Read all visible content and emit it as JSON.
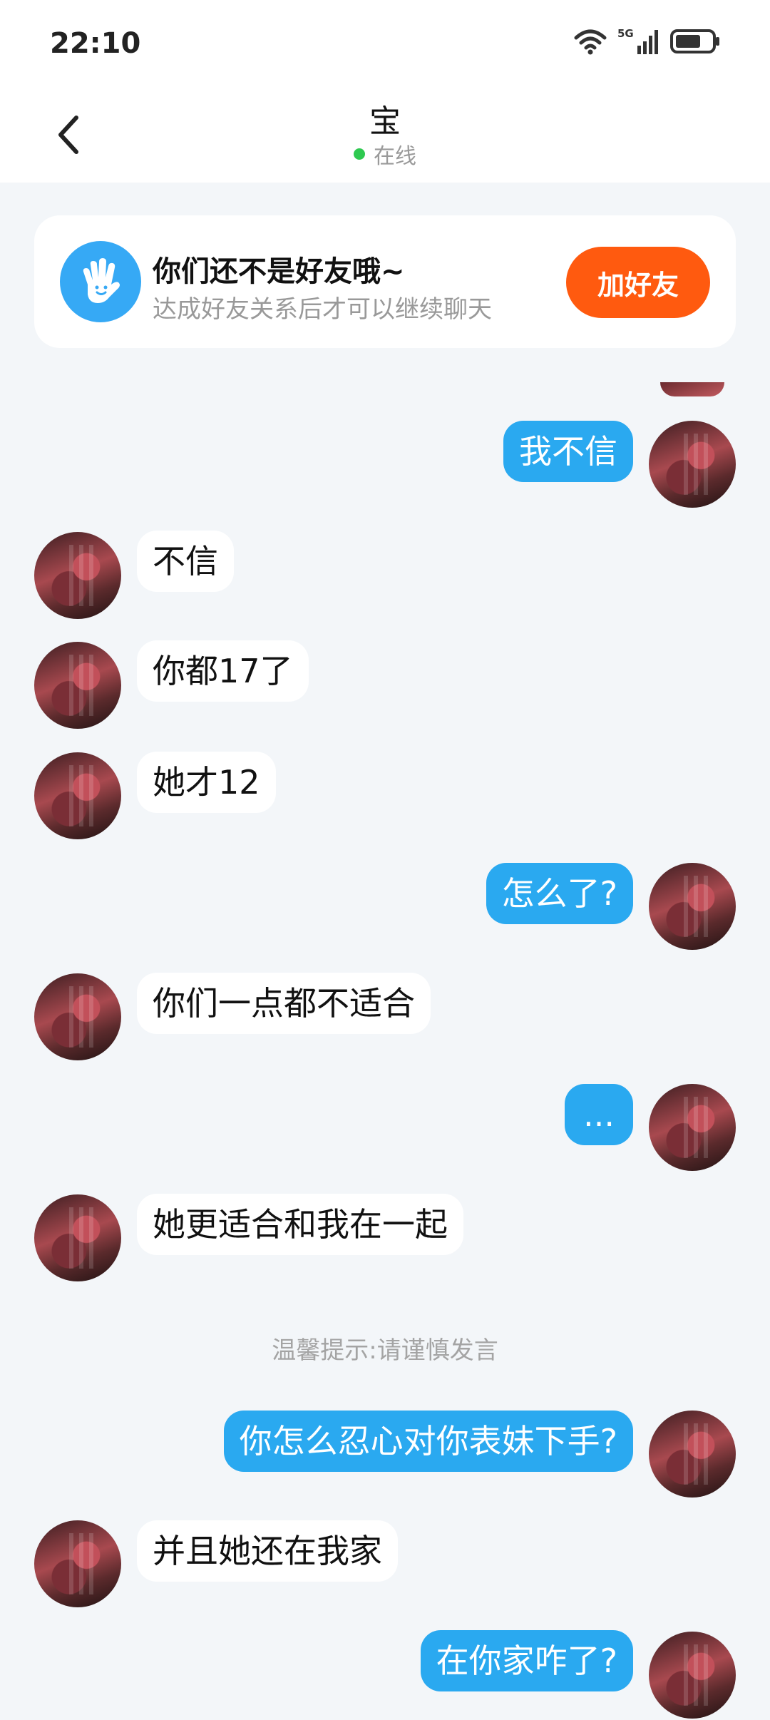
{
  "status_bar": {
    "time": "22:10",
    "network": "5G",
    "icons": [
      "wifi-icon",
      "signal-icon",
      "battery-icon"
    ]
  },
  "header": {
    "title": "宝",
    "status": "在线"
  },
  "friend_card": {
    "title": "你们还不是好友哦~",
    "subtitle": "达成好友关系后才可以继续聊天",
    "button": "加好友"
  },
  "messages": [
    {
      "side": "out",
      "text": "我不信"
    },
    {
      "side": "in",
      "text": "不信"
    },
    {
      "side": "in",
      "text": "你都17了"
    },
    {
      "side": "in",
      "text": "她才12"
    },
    {
      "side": "out",
      "text": "怎么了?"
    },
    {
      "side": "in",
      "text": "你们一点都不适合"
    },
    {
      "side": "out",
      "text": "..."
    },
    {
      "side": "in",
      "text": "她更适合和我在一起"
    },
    {
      "side": "out",
      "text": "你怎么忍心对你表妹下手?"
    },
    {
      "side": "in",
      "text": "并且她还在我家"
    },
    {
      "side": "out",
      "text": "在你家咋了?"
    }
  ],
  "tip": "温馨提示:请谨慎发言",
  "colors": {
    "accent_blue": "#2aa9f0",
    "add_friend_orange": "#ff5a0f",
    "online_green": "#2ec950",
    "background": "#f3f6f9"
  }
}
